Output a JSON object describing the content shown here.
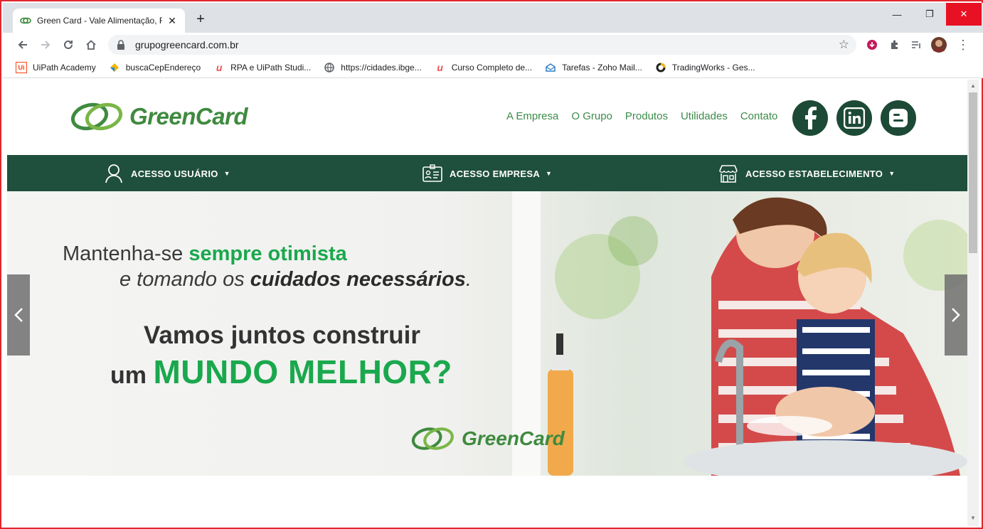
{
  "browser": {
    "tab_title": "Green Card - Vale Alimentação, R",
    "tab_close": "✕",
    "new_tab": "+",
    "url": "grupogreencard.com.br",
    "window": {
      "minimize": "—",
      "restore": "❐",
      "close": "✕"
    }
  },
  "bookmarks": [
    {
      "label": "UiPath Academy",
      "icon": "uipath-icon",
      "color": "#fa4616"
    },
    {
      "label": "buscaCepEndereço",
      "icon": "diamond-icon",
      "color": "#e8a000"
    },
    {
      "label": "RPA e UiPath Studi...",
      "icon": "udemy-icon",
      "color": "#ec5252"
    },
    {
      "label": "https://cidades.ibge...",
      "icon": "globe-icon",
      "color": "#5f6368"
    },
    {
      "label": "Curso Completo de...",
      "icon": "udemy-icon",
      "color": "#ec5252"
    },
    {
      "label": "Tarefas - Zoho Mail...",
      "icon": "mail-icon",
      "color": "#2d7ec4"
    },
    {
      "label": "TradingWorks - Ges...",
      "icon": "ring-icon",
      "color": "#333"
    }
  ],
  "site": {
    "logo_text": "GreenCard",
    "nav": [
      "A Empresa",
      "O Grupo",
      "Produtos",
      "Utilidades",
      "Contato"
    ],
    "access": [
      {
        "label": "ACESSO USUÁRIO",
        "icon": "user-icon"
      },
      {
        "label": "ACESSO EMPRESA",
        "icon": "badge-icon"
      },
      {
        "label": "ACESSO ESTABELECIMENTO",
        "icon": "store-icon"
      }
    ],
    "hero": {
      "line1_prefix": "Mantenha-se ",
      "line1_bold": "sempre otimista",
      "line2_prefix": "e tomando os ",
      "line2_bold": "cuidados necessários",
      "line2_suffix": ".",
      "line3": "Vamos juntos construir",
      "line4_prefix": "um ",
      "line4_bold": "MUNDO MELHOR?",
      "logo_text": "GreenCard"
    },
    "colors": {
      "brand_green": "#3d8b4a",
      "dark_green": "#1f4f3d",
      "accent": "#1aa84d"
    }
  }
}
